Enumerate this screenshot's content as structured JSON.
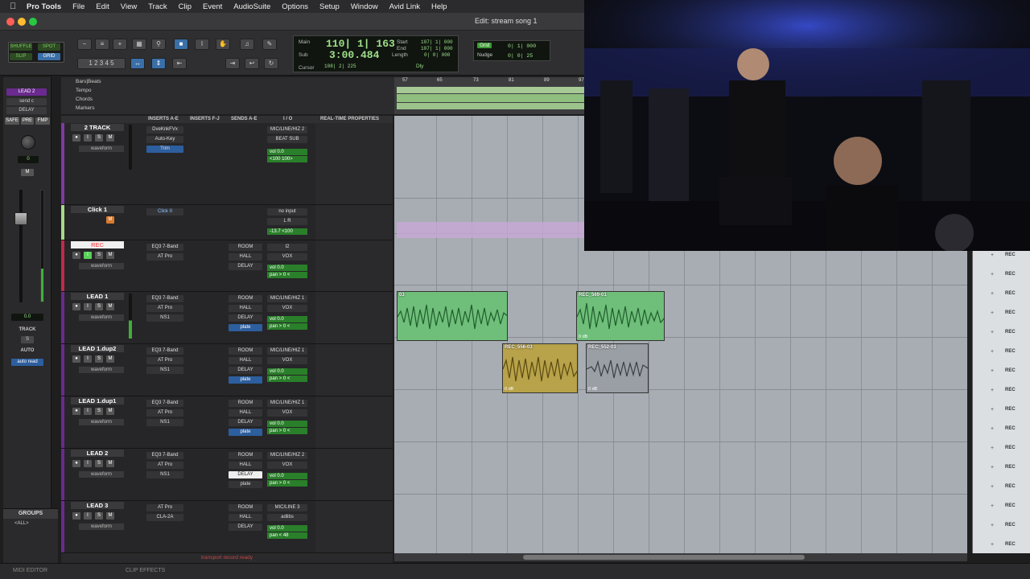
{
  "menubar": {
    "app": "Pro Tools",
    "items": [
      "File",
      "Edit",
      "View",
      "Track",
      "Clip",
      "Event",
      "AudioSuite",
      "Options",
      "Setup",
      "Window",
      "Avid Link",
      "Help"
    ]
  },
  "window": {
    "title": "Edit: stream song 1"
  },
  "toolbar": {
    "edit_modes": [
      "SHUFFLE",
      "SPOT",
      "SLIP",
      "GRID"
    ],
    "counter": {
      "main_label": "Main",
      "main_value": "110| 1| 163",
      "sub_label": "Sub",
      "sub_value": "3:00.484",
      "cursor_label": "Cursor",
      "cursor_value": "108| 2| 225",
      "start_label": "Start",
      "end_label": "End",
      "length_label": "Length",
      "start_value": "107| 1| 000",
      "end_value": "107| 1| 000",
      "length_value": "0| 0| 000",
      "dly_label": "Dly"
    },
    "grid": {
      "grid_label": "Grid",
      "grid_value": "0| 1| 000",
      "nudge_label": "Nudge",
      "nudge_value": "0| 0| 25"
    }
  },
  "left_column": {
    "track_name": "LEAD 2",
    "send": "send c",
    "delay": "DELAY",
    "safe_buttons": [
      "SAFE",
      "PRE",
      "FMP"
    ],
    "pan_value": "0",
    "fader_value": "0.0",
    "track_label": "TRACK",
    "auto_label": "AUTO",
    "auto_mode": "auto read"
  },
  "groups": {
    "title": "GROUPS",
    "all": "<ALL>"
  },
  "rulers": {
    "labels": [
      "Bars|Beats",
      "Tempo",
      "Chords",
      "Markers"
    ],
    "bar_numbers": [
      "57",
      "65",
      "73",
      "81",
      "89",
      "97"
    ]
  },
  "columns": {
    "inserts_ae": "INSERTS A-E",
    "inserts_fj": "INSERTS F-J",
    "sends_ae": "SENDS A-E",
    "io": "I / O",
    "rtp": "REAL-TIME PROPERTIES"
  },
  "tracks": [
    {
      "name": "2 TRACK",
      "view": "waveform",
      "inserts": [
        "DveKnkFVx",
        "Auto-Key",
        "Trim"
      ],
      "sends": [],
      "io": [
        "MIC/LINE/HIZ 2",
        "BEAT SUB"
      ],
      "vol": "vol  0.0",
      "pan": "<100  100>"
    },
    {
      "name": "Click 1",
      "view": "",
      "inserts": [
        "Click II"
      ],
      "sends": [],
      "io": [
        "no input",
        "L R"
      ],
      "vol": "-13.7  <100",
      "pan": ""
    },
    {
      "name": "REC",
      "view": "waveform",
      "inserts": [
        "EQ3 7-Band",
        "AT Pro"
      ],
      "sends": [
        "ROOM",
        "HALL",
        "DELAY"
      ],
      "io": [
        "I2",
        "VOX"
      ],
      "vol": "vol  0.0",
      "pan": "pan  > 0 <"
    },
    {
      "name": "LEAD 1",
      "view": "waveform",
      "inserts": [
        "EQ3 7-Band",
        "AT Pro",
        "NS1"
      ],
      "sends": [
        "ROOM",
        "HALL",
        "DELAY",
        "plate"
      ],
      "io": [
        "MIC/LINE/HIZ 1",
        "VOX"
      ],
      "vol": "vol  0.0",
      "pan": "pan  > 0 <"
    },
    {
      "name": "LEAD 1.dup2",
      "view": "waveform",
      "inserts": [
        "EQ3 7-Band",
        "AT Pro",
        "NS1"
      ],
      "sends": [
        "ROOM",
        "HALL",
        "DELAY",
        "plate"
      ],
      "io": [
        "MIC/LINE/HIZ 1",
        "VOX"
      ],
      "vol": "vol  0.0",
      "pan": "pan  > 0 <"
    },
    {
      "name": "LEAD 1.dup1",
      "view": "waveform",
      "inserts": [
        "EQ3 7-Band",
        "AT Pro",
        "NS1"
      ],
      "sends": [
        "ROOM",
        "HALL",
        "DELAY",
        "plate"
      ],
      "io": [
        "MIC/LINE/HIZ 1",
        "VOX"
      ],
      "vol": "vol  0.0",
      "pan": "pan  > 0 <"
    },
    {
      "name": "LEAD 2",
      "view": "waveform",
      "inserts": [
        "EQ3 7-Band",
        "AT Pro",
        "NS1"
      ],
      "sends": [
        "ROOM",
        "HALL",
        "DELAY",
        "plate"
      ],
      "io": [
        "MIC/LINE/HIZ 2",
        "VOX"
      ],
      "vol": "vol  0.0",
      "pan": "pan  > 0 <"
    },
    {
      "name": "LEAD 3",
      "view": "waveform",
      "inserts": [
        "AT Pro",
        "CLA-2A"
      ],
      "sends": [
        "ROOM",
        "HALL",
        "DELAY"
      ],
      "io": [
        "MIC/LINE 3",
        "adlibs"
      ],
      "vol": "vol  0.0",
      "pan": "pan  < 48"
    }
  ],
  "clips": [
    {
      "name": "03",
      "gain": "",
      "color": "#6fbf7a"
    },
    {
      "name": "REC_569-01",
      "gain": "0 dB",
      "color": "#6fbf7a"
    },
    {
      "name": "REC_556-03",
      "gain": "0 dB",
      "color": "#b8a24a"
    },
    {
      "name": "REC_552-03",
      "gain": "0 dB",
      "color": "#9a9fa5"
    }
  ],
  "right_list_label": "REC",
  "status_text": "transport record ready",
  "bottom_tabs": [
    "MIDI EDITOR",
    "",
    "CLIP EFFECTS"
  ],
  "colors": {
    "accent_green": "#9fe089",
    "track_purple": "#6a2a8f",
    "clip_green": "#6fbf7a"
  }
}
